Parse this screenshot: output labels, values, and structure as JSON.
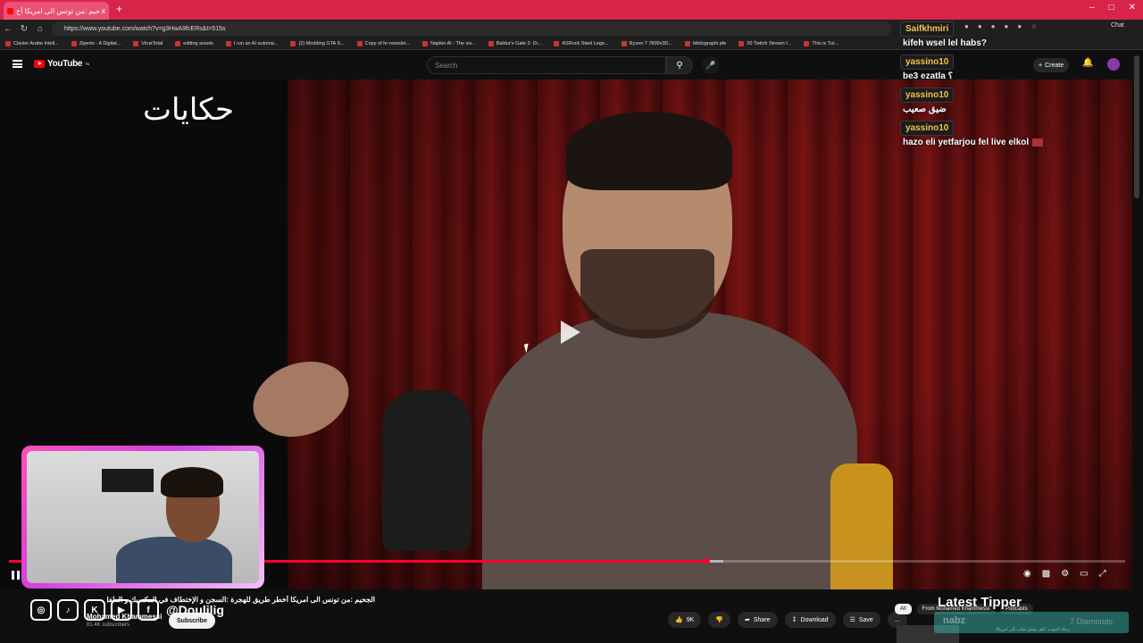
{
  "browser": {
    "tab_title": "الجحيم :من تونس الى امريكا أخ",
    "tab_close": "x",
    "new_tab": "+",
    "url": "https://www.youtube.com/watch?v=g3HwA9fcERs&t=515s",
    "bookmarks": [
      "Clavier Arabe Intell...",
      "Ziperto - A Digital...",
      "VirusTotal",
      "editing assets",
      "I run an AI automa...",
      "(2) Modding GTA S...",
      "Copy of hr-newslet...",
      "Napkin AI - The vis...",
      "Baldur's Gate 3: Di...",
      "ASRock Steel Lege...",
      "Ryzen 7 7800x3D...",
      "bibliographi pfe",
      "20 Twitch Stream I...",
      "This is Tur..."
    ],
    "chat_button": "Chat"
  },
  "youtube": {
    "logo_text": "YouTube",
    "logo_sup": "TN",
    "search_placeholder": "Search",
    "create_label": "Create"
  },
  "video": {
    "overlay_text": "حكايات",
    "progress_fraction": 0.625,
    "buffer_fraction": 0.64,
    "title": "الجحيم :من تونس الى امريكا أخطر طريق للهجرة :السجن و الإختطاف في المكسيك و الطفل ملتق !!",
    "channel": "Mohamed Khammessi",
    "subscribers": "81.4K subscribers",
    "subscribe_label": "Subscribe"
  },
  "actions": {
    "like_count": "9K",
    "share": "Share",
    "download": "Download",
    "save": "Save",
    "more": "..."
  },
  "sidebar": {
    "chips": [
      "All",
      "From Mohamed Khammessi",
      "Podcasts"
    ],
    "next_caption": "رحلة الموت: كيف وصل شاب إلى امريكا"
  },
  "stream_overlay": {
    "social_handle": "@Doulilig",
    "chat": [
      {
        "user": "Saifkhmiri",
        "text": "kifeh wsel lel habs?"
      },
      {
        "user": "yassino10",
        "text": "be3 ezatla ؟"
      },
      {
        "user": "yassino10",
        "text": "ضيق صعيب"
      },
      {
        "user": "yassino10",
        "text": "hazo eli yetfarjou fel live elkol"
      }
    ],
    "tipper_title": "Latest Tipper",
    "tipper_name": "nabz",
    "tipper_amount": "7 Diamonds"
  },
  "colors": {
    "tab_bar": "#d9244a",
    "progress": "#ff0033",
    "chat_username": "#f3c24b",
    "webcam_border": "#ff4fb8"
  }
}
